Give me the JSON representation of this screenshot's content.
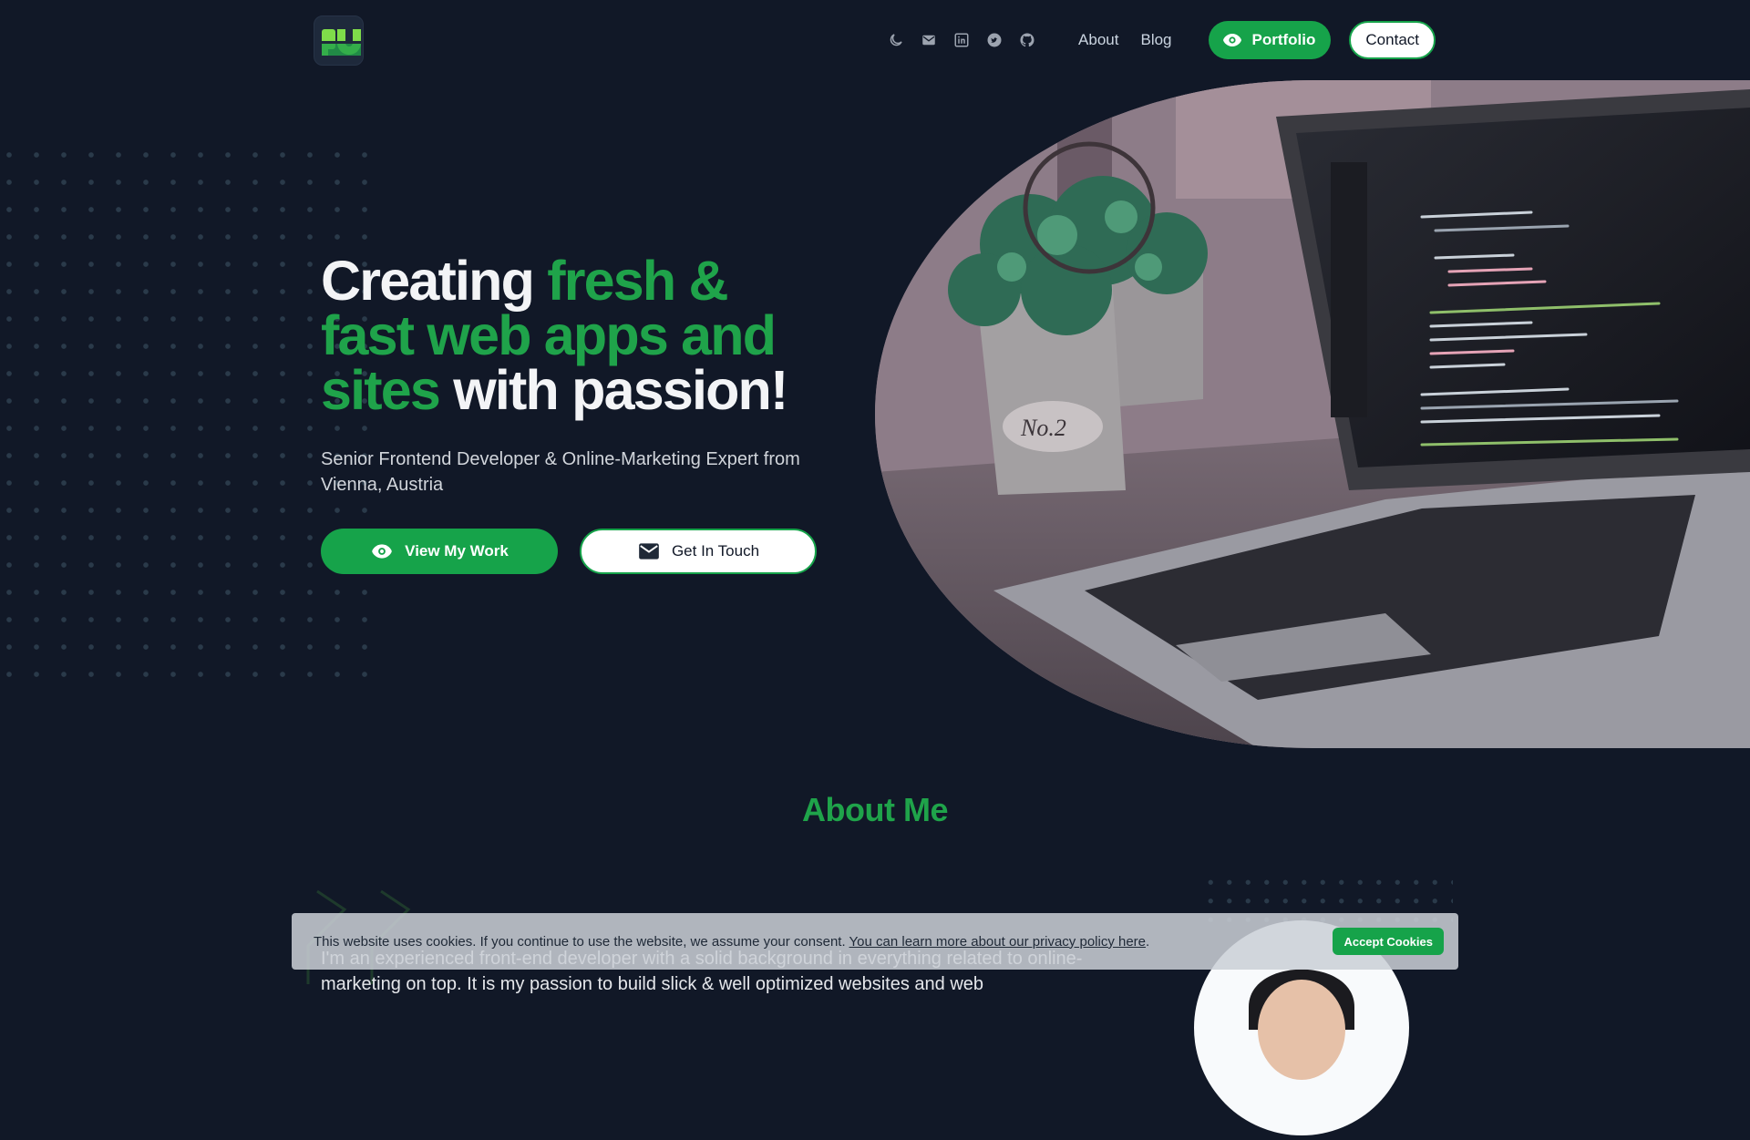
{
  "nav": {
    "icons": [
      "moon-icon",
      "mail-icon",
      "linkedin-icon",
      "twitter-icon",
      "github-icon"
    ],
    "links": [
      "About",
      "Blog"
    ],
    "portfolio_label": "Portfolio",
    "contact_label": "Contact"
  },
  "hero": {
    "title_part1": "Creating ",
    "title_accent": "fresh & fast web apps and sites",
    "title_part2": " with passion!",
    "subtitle": "Senior Frontend Developer & Online-Marketing Expert from Vienna, Austria",
    "primary_button": "View My Work",
    "secondary_button": "Get In Touch"
  },
  "about": {
    "title": "About Me",
    "text": "I'm an experienced front-end developer with a solid background in everything related to online-marketing on top. It is my passion to build slick & well optimized websites and web"
  },
  "cookie": {
    "text": "This website uses cookies. If you continue to use the website, we assume your consent.",
    "link": "You can learn more about our privacy policy here",
    "end": ".",
    "button": "Accept Cookies"
  },
  "colors": {
    "background": "#111827",
    "accent": "#16a34a",
    "text": "#e5e7eb"
  }
}
